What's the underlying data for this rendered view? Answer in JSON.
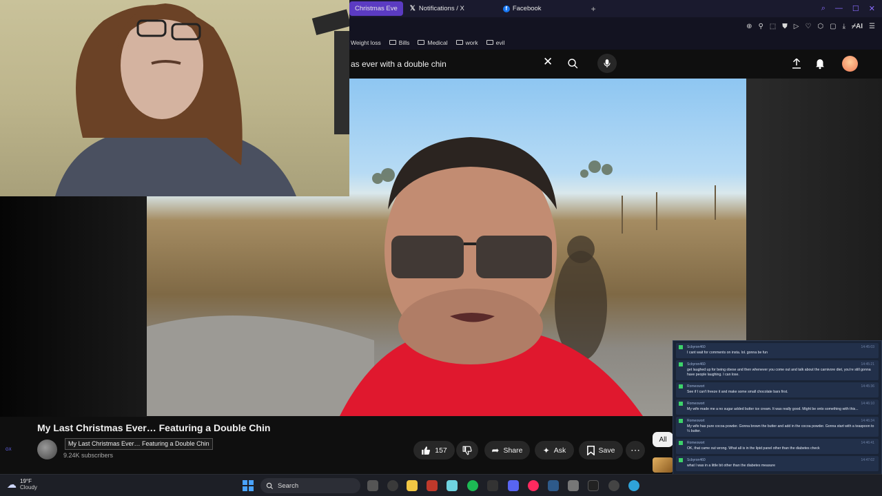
{
  "browser": {
    "tabs": [
      {
        "label": "Christmas Eve",
        "active": true
      },
      {
        "label": "Notifications / X",
        "icon": "x-logo-icon"
      },
      {
        "label": "Facebook",
        "icon": "facebook-icon"
      }
    ],
    "toolbar_ai_label": "AI",
    "bookmarks": [
      "Weight loss",
      "Bills",
      "Medical",
      "work",
      "evil"
    ]
  },
  "youtube": {
    "search_value": "as ever with a double chin",
    "video_title": "My Last Christmas Ever… Featuring a Double Chin",
    "tooltip": "My Last Christmas Ever… Featuring a Double Chin",
    "subscribers": "9.24K subscribers",
    "likes": "157",
    "share_label": "Share",
    "ask_label": "Ask",
    "save_label": "Save",
    "filter_all": "All"
  },
  "chat": {
    "messages": [
      {
        "user": "Scbyron460",
        "time": "14:45:03",
        "text": "I cant wait for comments on insta. lol. gonna be fun"
      },
      {
        "user": "Scbyron460",
        "time": "14:45:21",
        "text": "get laughed up for being obese and then whenever you come out and talk about the carnivore diet, you're still gonna have people laughing. I can lose."
      },
      {
        "user": "Romeowort",
        "time": "14:45:36",
        "text": "See if I can't freeze it and make some small chocolate bars first."
      },
      {
        "user": "Romeowort",
        "time": "14:46:10",
        "text": "My wife made me a no sugar added butter ice cream. It was really good. Might be onto something with this..."
      },
      {
        "user": "Romeowort",
        "time": "14:46:34",
        "text": "My wife has pure cocoa powder. Gonna brown the butter and add in the cocoa powder. Gonna start with a teaspoon to ¼ butter."
      },
      {
        "user": "Romeowort",
        "time": "14:46:41",
        "text": "OK, that came out wrong. What all is in the lipid panel other than the diabetes check"
      },
      {
        "user": "Scbyron460",
        "time": "14:47:02",
        "text": "what I was in a little bit other than the diabetes measure"
      }
    ]
  },
  "taskbar": {
    "temperature": "19°F",
    "condition": "Cloudy",
    "search_placeholder": "Search"
  },
  "left_rail": {
    "label": "GX"
  },
  "colors": {
    "accent": "#5b3bc2",
    "chat_bg": "#1a2436",
    "yt_bg": "#0f0f0f"
  }
}
